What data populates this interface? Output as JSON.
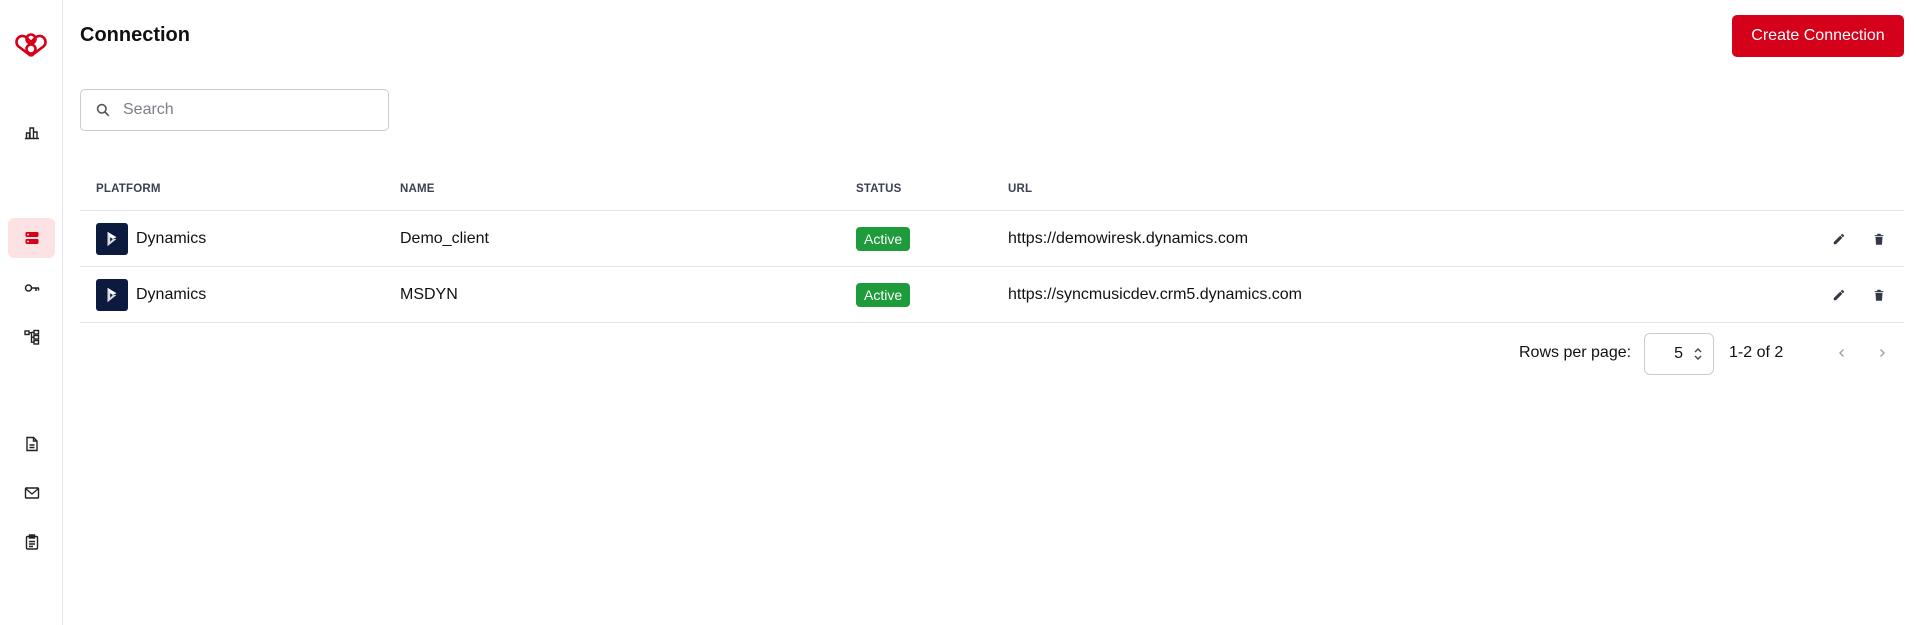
{
  "sidebar": {
    "logo": "brand-logo",
    "items": [
      {
        "name": "dashboard",
        "icon": "bar-chart-icon",
        "active": false
      },
      {
        "name": "connections",
        "icon": "database-icon",
        "active": true
      },
      {
        "name": "keys",
        "icon": "key-icon",
        "active": false
      },
      {
        "name": "workflows",
        "icon": "hierarchy-icon",
        "active": false
      },
      {
        "name": "documents",
        "icon": "document-icon",
        "active": false
      },
      {
        "name": "mail",
        "icon": "mail-icon",
        "active": false
      },
      {
        "name": "clipboard",
        "icon": "clipboard-icon",
        "active": false
      }
    ]
  },
  "header": {
    "title": "Connection",
    "create_label": "Create Connection"
  },
  "search": {
    "placeholder": "Search",
    "value": ""
  },
  "table": {
    "columns": [
      "PLATFORM",
      "NAME",
      "STATUS",
      "URL"
    ],
    "rows": [
      {
        "platform": "Dynamics",
        "name": "Demo_client",
        "status": "Active",
        "url": "https://demowiresk.dynamics.com"
      },
      {
        "platform": "Dynamics",
        "name": "MSDYN",
        "status": "Active",
        "url": "https://syncmusicdev.crm5.dynamics.com"
      }
    ]
  },
  "pagination": {
    "rows_per_page_label": "Rows per page:",
    "rows_per_page": "5",
    "range": "1-2 of 2"
  },
  "colors": {
    "accent": "#d50019",
    "active_bg": "#fde2e4",
    "status_active": "#1e9b3a",
    "dynamics_icon_bg": "#0b1a3d"
  }
}
